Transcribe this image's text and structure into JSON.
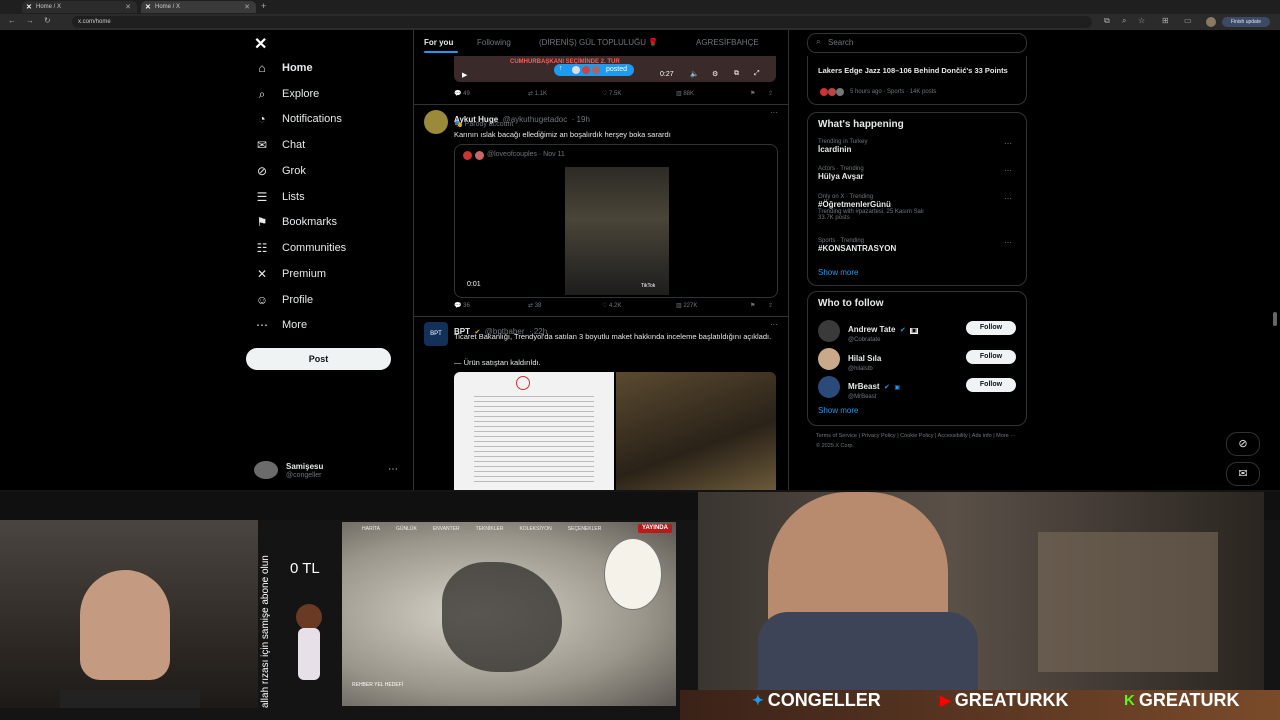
{
  "browser": {
    "tabs": [
      {
        "label": "Home / X",
        "active": false
      },
      {
        "label": "Home / X",
        "active": true
      }
    ],
    "new_tab": "+",
    "url": "x.com/home",
    "finish_update": "Finish update"
  },
  "sidebar": {
    "items": [
      {
        "label": "Home",
        "icon": "home-icon",
        "glyph": "⌂"
      },
      {
        "label": "Explore",
        "icon": "search-icon",
        "glyph": "⌕"
      },
      {
        "label": "Notifications",
        "icon": "bell-icon",
        "glyph": "◔"
      },
      {
        "label": "Chat",
        "icon": "mail-icon",
        "glyph": "✉"
      },
      {
        "label": "Grok",
        "icon": "grok-icon",
        "glyph": "⊘"
      },
      {
        "label": "Lists",
        "icon": "list-icon",
        "glyph": "☰"
      },
      {
        "label": "Bookmarks",
        "icon": "bookmark-icon",
        "glyph": "⚑"
      },
      {
        "label": "Communities",
        "icon": "communities-icon",
        "glyph": "☷"
      },
      {
        "label": "Premium",
        "icon": "x-logo-icon",
        "glyph": "✕"
      },
      {
        "label": "Profile",
        "icon": "person-icon",
        "glyph": "☺"
      },
      {
        "label": "More",
        "icon": "more-icon",
        "glyph": "⋯"
      }
    ],
    "post_label": "Post",
    "account": {
      "name": "Samişesu",
      "handle": "@congeller"
    }
  },
  "feed": {
    "tabs": [
      "For you",
      "Following",
      "(DİRENİŞ) GÜL TOPLULUĞU 🌹",
      "AGRESİFBAHÇE"
    ],
    "top_media": {
      "caption": "CUMHURBAŞKANI SEÇİMİNDE 2. TUR",
      "time": "0:27",
      "posted": "posted"
    },
    "top_actions": {
      "replies": "49",
      "reposts": "1.1K",
      "likes": "7.5K",
      "views": "88K"
    },
    "tweets": [
      {
        "name": "Aykut Huge",
        "handle": "@aykuthugetadoc",
        "time": "· 19h",
        "badge": "Parody account",
        "text": "Karının ıslak bacağı elledi̇ğimiz an boşalırdık herşey boka sarardı",
        "quote": {
          "handle": "@loveofcouples",
          "time": "· Nov 11",
          "duration": "0:01",
          "watermark": "TikTok"
        },
        "actions": {
          "replies": "36",
          "reposts": "38",
          "likes": "4.2K",
          "views": "227K"
        }
      },
      {
        "name": "BPT",
        "handle": "@bpthaber",
        "time": "· 22h",
        "text": "Ticaret Bakanlığı, Trendyol'da satılan 3 boyutlu maket hakkında inceleme başlatıldığını açıkladı.",
        "text2": "— Ürün satıştan kaldırıldı."
      }
    ]
  },
  "right": {
    "search_placeholder": "Search",
    "top_trend": {
      "title": "Lakers Edge Jazz 108–106 Behind Dončić's 33 Points",
      "meta": "5 hours ago · Sports · 14K posts"
    },
    "happening": {
      "title": "What's happening",
      "trends": [
        {
          "meta": "Trending in Turkey",
          "name": "İcardinin"
        },
        {
          "meta": "Actors · Trending",
          "name": "Hülya Avşar"
        },
        {
          "meta": "Only on X · Trending",
          "name": "#ÖğretmenlerGünü",
          "extra": "Trending with #pazartesi, 25 Kasım Salı",
          "count": "33.7K posts"
        },
        {
          "meta": "Sports · Trending",
          "name": "#KONSANTRASYON"
        }
      ],
      "show_more": "Show more"
    },
    "who_to_follow": {
      "title": "Who to follow",
      "users": [
        {
          "name": "Andrew Tate",
          "handle": "@Cobratate"
        },
        {
          "name": "Hilal Sıla",
          "handle": "@hilalstb"
        },
        {
          "name": "MrBeast",
          "handle": "@MrBeast"
        }
      ],
      "follow_label": "Follow",
      "show_more": "Show more"
    },
    "footer": "Terms of Service | Privacy Policy | Cookie Policy | Accessibility | Ads info | More ··· © 2025 X Corp."
  },
  "overlay": {
    "left_vertical": "allah rızası için samişe abone olun",
    "money": "0 TL",
    "map_banner": "YAYINDA",
    "map_tabs": [
      "HARİTA",
      "GÜNLÜK",
      "ENVANTER",
      "TEKNİKLER",
      "KOLEKSİYON",
      "SEÇENEKLER"
    ],
    "map_bottom": "REHBER YEL HEDEFİ",
    "socials": [
      {
        "icon": "twitter-icon",
        "label": "CONGELLER",
        "color": "#1d9bf0"
      },
      {
        "icon": "youtube-icon",
        "label": "GREATURKK",
        "color": "#ff0000"
      },
      {
        "icon": "kick-icon",
        "label": "GREATURK",
        "color": "#53fc18"
      }
    ]
  }
}
